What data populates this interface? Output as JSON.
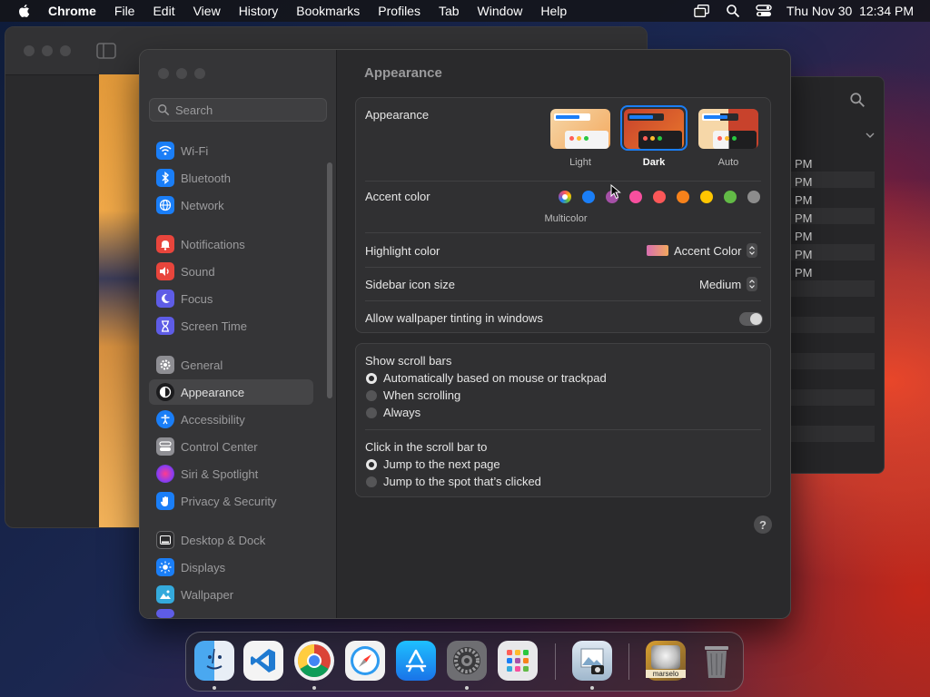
{
  "menubar": {
    "app_name": "Chrome",
    "items": [
      "File",
      "Edit",
      "View",
      "History",
      "Bookmarks",
      "Profiles",
      "Tab",
      "Window",
      "Help"
    ],
    "clock": "Thu Nov 30  12:34 PM"
  },
  "background_window": {
    "pm_labels": [
      "PM",
      "PM",
      "PM",
      "PM",
      "PM",
      "PM",
      "PM"
    ]
  },
  "sidebar": {
    "search_placeholder": "Search",
    "items": [
      {
        "label": "Wi-Fi",
        "icon": "wifi-icon",
        "color": "#1a7ef7"
      },
      {
        "label": "Bluetooth",
        "icon": "bluetooth-icon",
        "color": "#1a7ef7"
      },
      {
        "label": "Network",
        "icon": "globe-icon",
        "color": "#1a7ef7"
      },
      {
        "label": "Notifications",
        "icon": "bell-icon",
        "color": "#e8453c"
      },
      {
        "label": "Sound",
        "icon": "speaker-icon",
        "color": "#e8453c"
      },
      {
        "label": "Focus",
        "icon": "moon-icon",
        "color": "#5e5ce6"
      },
      {
        "label": "Screen Time",
        "icon": "hourglass-icon",
        "color": "#5e5ce6"
      },
      {
        "label": "General",
        "icon": "gear-icon",
        "color": "#8e8e93"
      },
      {
        "label": "Appearance",
        "icon": "appearance-icon",
        "color": "#1c1c1e"
      },
      {
        "label": "Accessibility",
        "icon": "accessibility-icon",
        "color": "#1a7ef7"
      },
      {
        "label": "Control Center",
        "icon": "control-center-icon",
        "color": "#8e8e93"
      },
      {
        "label": "Siri & Spotlight",
        "icon": "siri-icon",
        "color": "#b03ad8"
      },
      {
        "label": "Privacy & Security",
        "icon": "hand-icon",
        "color": "#1a7ef7"
      },
      {
        "label": "Desktop & Dock",
        "icon": "dock-icon",
        "color": "#2c2c2e"
      },
      {
        "label": "Displays",
        "icon": "sun-icon",
        "color": "#1a7ef7"
      },
      {
        "label": "Wallpaper",
        "icon": "wallpaper-icon",
        "color": "#34aadc"
      }
    ],
    "selected": "Appearance"
  },
  "content": {
    "title": "Appearance",
    "appearance": {
      "label": "Appearance",
      "options": [
        "Light",
        "Dark",
        "Auto"
      ],
      "selected": "Dark"
    },
    "accent": {
      "label": "Accent color",
      "caption": "Multicolor",
      "colors": [
        "#multicolor",
        "#1a7ef7",
        "#a550a7",
        "#f74f9e",
        "#fc5758",
        "#f7821b",
        "#ffc600",
        "#62ba46",
        "#8c8c8c"
      ]
    },
    "highlight": {
      "label": "Highlight color",
      "value": "Accent Color"
    },
    "sidebar_icon_size": {
      "label": "Sidebar icon size",
      "value": "Medium"
    },
    "wallpaper_tinting": {
      "label": "Allow wallpaper tinting in windows",
      "enabled": true
    },
    "scroll_bars": {
      "label": "Show scroll bars",
      "options": [
        "Automatically based on mouse or trackpad",
        "When scrolling",
        "Always"
      ],
      "selected": 0
    },
    "click_scroll": {
      "label": "Click in the scroll bar to",
      "options": [
        "Jump to the next page",
        "Jump to the spot that’s clicked"
      ],
      "selected": 0
    },
    "help": "?"
  },
  "dock": {
    "apps": [
      "Finder",
      "Visual Studio Code",
      "Google Chrome",
      "Safari",
      "App Store",
      "System Settings",
      "Launchpad",
      "Preview",
      "marselo",
      "Trash"
    ],
    "folder_label": "marselo"
  }
}
